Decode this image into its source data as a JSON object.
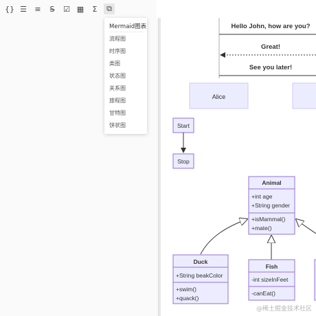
{
  "toolbar": {
    "buttons": [
      {
        "name": "code-block-button",
        "glyph": "{}"
      },
      {
        "name": "unordered-list-button",
        "glyph": "☰"
      },
      {
        "name": "ordered-list-button",
        "glyph": "≡"
      },
      {
        "name": "strikethrough-button",
        "glyph": "S̶"
      },
      {
        "name": "checklist-button",
        "glyph": "☑"
      },
      {
        "name": "table-button",
        "glyph": "▦"
      },
      {
        "name": "formula-button",
        "glyph": "Σ"
      },
      {
        "name": "diagram-button",
        "glyph": "⧉"
      }
    ]
  },
  "dropdown": {
    "title": "Mermaid图表",
    "items": [
      "流程图",
      "时序图",
      "类图",
      "状态图",
      "关系图",
      "旅程图",
      "甘特图",
      "饼状图"
    ]
  },
  "sequence": {
    "messages": [
      "Hello John, how are you?",
      "Great!",
      "See you later!"
    ],
    "participant": "Alice"
  },
  "state": {
    "start": "Start",
    "stop": "Stop"
  },
  "classes": {
    "animal": {
      "name": "Animal",
      "attrs": [
        "+int age",
        "+String gender"
      ],
      "methods": [
        "+isMammal()",
        "+mate()"
      ]
    },
    "duck": {
      "name": "Duck",
      "attrs": [
        "+String beakColor"
      ],
      "methods": [
        "+swim()",
        "+quack()"
      ]
    },
    "fish": {
      "name": "Fish",
      "attrs": [
        "-int sizeInFeet"
      ],
      "methods": [
        "-canEat()"
      ]
    }
  },
  "watermark": "@稀土掘金技术社区",
  "colors": {
    "node_fill": "#ECECFF",
    "node_stroke": "#9370DB",
    "line": "#333333"
  }
}
